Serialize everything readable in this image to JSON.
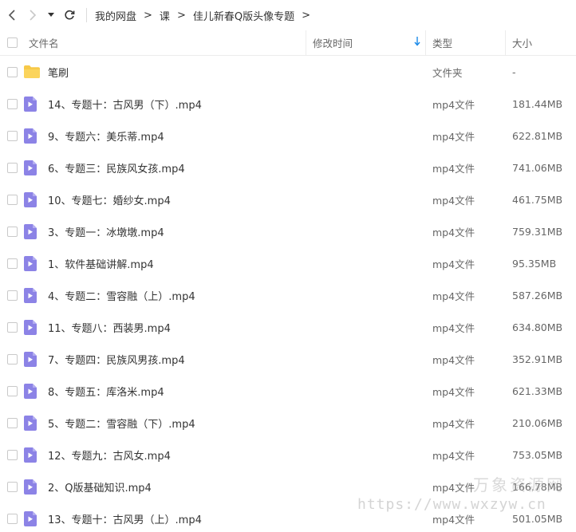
{
  "nav": {
    "breadcrumb": [
      "我的网盘",
      "课",
      "佳儿新春Q版头像专题"
    ],
    "separator": ">"
  },
  "header": {
    "name": "文件名",
    "mtime": "修改时间",
    "type": "类型",
    "size": "大小"
  },
  "colors": {
    "folder": "#f7c948",
    "video": "#8c83e6",
    "sort_arrow": "#1a8ae8"
  },
  "rows": [
    {
      "name": "笔刷",
      "type": "文件夹",
      "size": "-",
      "icon": "folder-icon"
    },
    {
      "name": "14、专题十：古风男（下）.mp4",
      "type": "mp4文件",
      "size": "181.44MB",
      "icon": "video-file-icon"
    },
    {
      "name": "9、专题六：美乐蒂.mp4",
      "type": "mp4文件",
      "size": "622.81MB",
      "icon": "video-file-icon"
    },
    {
      "name": "6、专题三：民族风女孩.mp4",
      "type": "mp4文件",
      "size": "741.06MB",
      "icon": "video-file-icon"
    },
    {
      "name": "10、专题七：婚纱女.mp4",
      "type": "mp4文件",
      "size": "461.75MB",
      "icon": "video-file-icon"
    },
    {
      "name": "3、专题一：冰墩墩.mp4",
      "type": "mp4文件",
      "size": "759.31MB",
      "icon": "video-file-icon"
    },
    {
      "name": "1、软件基础讲解.mp4",
      "type": "mp4文件",
      "size": "95.35MB",
      "icon": "video-file-icon"
    },
    {
      "name": "4、专题二：雪容融（上）.mp4",
      "type": "mp4文件",
      "size": "587.26MB",
      "icon": "video-file-icon"
    },
    {
      "name": "11、专题八：西装男.mp4",
      "type": "mp4文件",
      "size": "634.80MB",
      "icon": "video-file-icon"
    },
    {
      "name": "7、专题四：民族风男孩.mp4",
      "type": "mp4文件",
      "size": "352.91MB",
      "icon": "video-file-icon"
    },
    {
      "name": "8、专题五：库洛米.mp4",
      "type": "mp4文件",
      "size": "621.33MB",
      "icon": "video-file-icon"
    },
    {
      "name": "5、专题二：雪容融（下）.mp4",
      "type": "mp4文件",
      "size": "210.06MB",
      "icon": "video-file-icon"
    },
    {
      "name": "12、专题九：古风女.mp4",
      "type": "mp4文件",
      "size": "753.05MB",
      "icon": "video-file-icon"
    },
    {
      "name": "2、Q版基础知识.mp4",
      "type": "mp4文件",
      "size": "166.78MB",
      "icon": "video-file-icon"
    },
    {
      "name": "13、专题十：古风男（上）.mp4",
      "type": "mp4文件",
      "size": "501.05MB",
      "icon": "video-file-icon"
    }
  ],
  "watermark": {
    "text": "万象资源网",
    "url": "https://www.wxzyw.cn"
  }
}
